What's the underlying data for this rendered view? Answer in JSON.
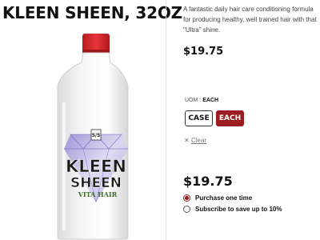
{
  "product": {
    "title": "KLEEN SHEEN, 32OZ",
    "description": "A fantastic daily hair care conditioning formula for producing healthy, well trained hair with that \"Ultra\" shine.",
    "price_top": "$19.75",
    "price_bottom": "$19.75"
  },
  "image": {
    "alt": "Kleen Sheen bottle",
    "label_brand_line1": "KLEEN",
    "label_brand_line2": "SHEEN",
    "label_sub": "VITA HAIR",
    "label_badge": "5/5",
    "cap_color": "#d9242b",
    "bottle_color": "#f4f4f4"
  },
  "options": {
    "uom_label": "UOM",
    "uom_value": "EACH",
    "choices": [
      "CASE",
      "EACH"
    ],
    "selected": "EACH",
    "clear_label": "Clear"
  },
  "purchase": {
    "one_time": "Purchase one time",
    "subscribe": "Subscribe to save up to 10%",
    "selected": "one_time"
  },
  "colors": {
    "accent": "#9d1c21"
  }
}
